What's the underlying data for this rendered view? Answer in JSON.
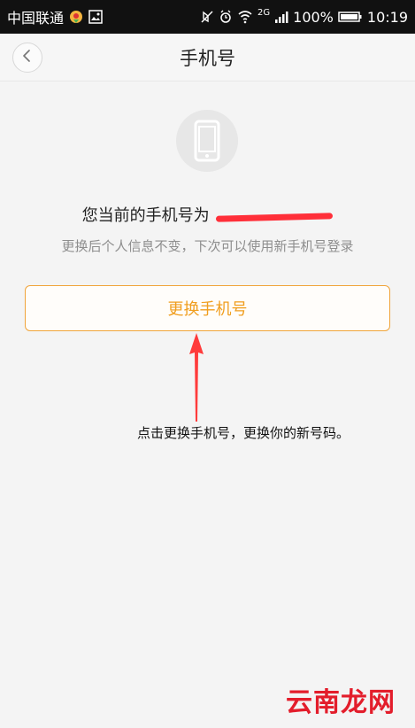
{
  "status_bar": {
    "carrier": "中国联通",
    "network": "2G",
    "battery": "100%",
    "time": "10:19"
  },
  "nav": {
    "title": "手机号"
  },
  "content": {
    "current_phone_prefix": "您当前的手机号为",
    "masked_phone_number": "[redacted]",
    "subtitle": "更换后个人信息不变，下次可以使用新手机号登录",
    "change_button": "更换手机号",
    "annotation": "点击更换手机号，更换你的新号码。"
  },
  "watermark": {
    "text": "云南龙网"
  },
  "colors": {
    "accent": "#f09e1f",
    "mask": "#ff2f39",
    "status_bar": "#111111",
    "background": "#f4f4f4"
  }
}
